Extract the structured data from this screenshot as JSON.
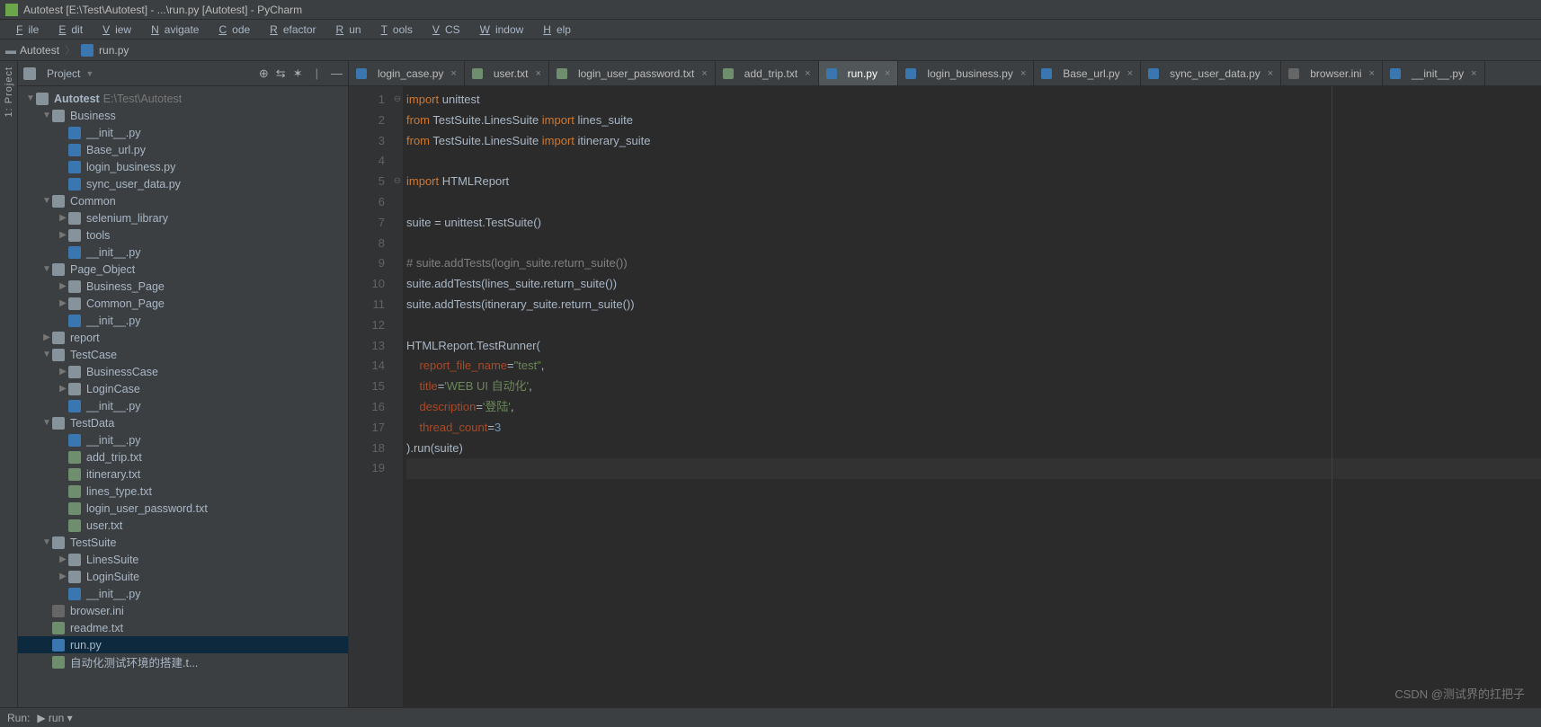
{
  "title": "Autotest [E:\\Test\\Autotest] - ...\\run.py [Autotest] - PyCharm",
  "menu": [
    "File",
    "Edit",
    "View",
    "Navigate",
    "Code",
    "Refactor",
    "Run",
    "Tools",
    "VCS",
    "Window",
    "Help"
  ],
  "crumbs": {
    "root": "Autotest",
    "file": "run.py"
  },
  "sidebar": {
    "title": "Project",
    "tree": [
      {
        "d": 0,
        "a": "d",
        "ic": "fold",
        "t": "Autotest",
        "p": "E:\\Test\\Autotest",
        "b": true
      },
      {
        "d": 1,
        "a": "d",
        "ic": "pkg",
        "t": "Business"
      },
      {
        "d": 2,
        "a": "n",
        "ic": "py",
        "t": "__init__.py"
      },
      {
        "d": 2,
        "a": "n",
        "ic": "py",
        "t": "Base_url.py"
      },
      {
        "d": 2,
        "a": "n",
        "ic": "py",
        "t": "login_business.py"
      },
      {
        "d": 2,
        "a": "n",
        "ic": "py",
        "t": "sync_user_data.py"
      },
      {
        "d": 1,
        "a": "d",
        "ic": "pkg",
        "t": "Common"
      },
      {
        "d": 2,
        "a": "r",
        "ic": "pkg",
        "t": "selenium_library"
      },
      {
        "d": 2,
        "a": "r",
        "ic": "pkg",
        "t": "tools"
      },
      {
        "d": 2,
        "a": "n",
        "ic": "py",
        "t": "__init__.py"
      },
      {
        "d": 1,
        "a": "d",
        "ic": "pkg",
        "t": "Page_Object"
      },
      {
        "d": 2,
        "a": "r",
        "ic": "pkg",
        "t": "Business_Page"
      },
      {
        "d": 2,
        "a": "r",
        "ic": "pkg",
        "t": "Common_Page"
      },
      {
        "d": 2,
        "a": "n",
        "ic": "py",
        "t": "__init__.py"
      },
      {
        "d": 1,
        "a": "r",
        "ic": "fold",
        "t": "report"
      },
      {
        "d": 1,
        "a": "d",
        "ic": "pkg",
        "t": "TestCase"
      },
      {
        "d": 2,
        "a": "r",
        "ic": "pkg",
        "t": "BusinessCase"
      },
      {
        "d": 2,
        "a": "r",
        "ic": "pkg",
        "t": "LoginCase"
      },
      {
        "d": 2,
        "a": "n",
        "ic": "py",
        "t": "__init__.py"
      },
      {
        "d": 1,
        "a": "d",
        "ic": "pkg",
        "t": "TestData"
      },
      {
        "d": 2,
        "a": "n",
        "ic": "py",
        "t": "__init__.py"
      },
      {
        "d": 2,
        "a": "n",
        "ic": "txt",
        "t": "add_trip.txt"
      },
      {
        "d": 2,
        "a": "n",
        "ic": "txt",
        "t": "itinerary.txt"
      },
      {
        "d": 2,
        "a": "n",
        "ic": "txt",
        "t": "lines_type.txt"
      },
      {
        "d": 2,
        "a": "n",
        "ic": "txt",
        "t": "login_user_password.txt"
      },
      {
        "d": 2,
        "a": "n",
        "ic": "txt",
        "t": "user.txt"
      },
      {
        "d": 1,
        "a": "d",
        "ic": "pkg",
        "t": "TestSuite"
      },
      {
        "d": 2,
        "a": "r",
        "ic": "pkg",
        "t": "LinesSuite"
      },
      {
        "d": 2,
        "a": "r",
        "ic": "pkg",
        "t": "LoginSuite"
      },
      {
        "d": 2,
        "a": "n",
        "ic": "py",
        "t": "__init__.py"
      },
      {
        "d": 1,
        "a": "n",
        "ic": "ini",
        "t": "browser.ini"
      },
      {
        "d": 1,
        "a": "n",
        "ic": "txt",
        "t": "readme.txt"
      },
      {
        "d": 1,
        "a": "n",
        "ic": "py",
        "t": "run.py",
        "sel": true
      },
      {
        "d": 1,
        "a": "n",
        "ic": "txt",
        "t": "自动化测试环境的搭建.t..."
      }
    ]
  },
  "tabs": [
    {
      "ic": "py",
      "t": "login_case.py"
    },
    {
      "ic": "txt",
      "t": "user.txt"
    },
    {
      "ic": "txt",
      "t": "login_user_password.txt"
    },
    {
      "ic": "txt",
      "t": "add_trip.txt"
    },
    {
      "ic": "py",
      "t": "run.py",
      "active": true
    },
    {
      "ic": "py",
      "t": "login_business.py"
    },
    {
      "ic": "py",
      "t": "Base_url.py"
    },
    {
      "ic": "py",
      "t": "sync_user_data.py"
    },
    {
      "ic": "ini",
      "t": "browser.ini"
    },
    {
      "ic": "py",
      "t": "__init__.py"
    }
  ],
  "code": {
    "lines": [
      [
        {
          "c": "kw",
          "t": "import"
        },
        {
          "t": " unittest"
        }
      ],
      [
        {
          "c": "kw",
          "t": "from"
        },
        {
          "t": " TestSuite.LinesSuite "
        },
        {
          "c": "kw",
          "t": "import"
        },
        {
          "t": " lines_suite"
        }
      ],
      [
        {
          "c": "kw",
          "t": "from"
        },
        {
          "t": " TestSuite.LinesSuite "
        },
        {
          "c": "kw",
          "t": "import"
        },
        {
          "t": " itinerary_suite"
        }
      ],
      [],
      [
        {
          "c": "kw",
          "t": "import"
        },
        {
          "t": " HTMLReport"
        }
      ],
      [],
      [
        {
          "t": "suite = unittest.TestSuite()"
        }
      ],
      [],
      [
        {
          "c": "cmt",
          "t": "# suite.addTests(login_suite.return_suite())"
        }
      ],
      [
        {
          "t": "suite.addTests(lines_suite.return_suite())"
        }
      ],
      [
        {
          "t": "suite.addTests(itinerary_suite.return_suite())"
        }
      ],
      [],
      [
        {
          "t": "HTMLReport.TestRunner("
        }
      ],
      [
        {
          "t": "    "
        },
        {
          "c": "kwarg",
          "t": "report_file_name"
        },
        {
          "t": "="
        },
        {
          "c": "str",
          "t": "\"test\""
        },
        {
          "t": ","
        }
      ],
      [
        {
          "t": "    "
        },
        {
          "c": "kwarg",
          "t": "title"
        },
        {
          "t": "="
        },
        {
          "c": "str",
          "t": "'WEB UI 自动化'"
        },
        {
          "t": ","
        }
      ],
      [
        {
          "t": "    "
        },
        {
          "c": "kwarg",
          "t": "description"
        },
        {
          "t": "="
        },
        {
          "c": "str",
          "t": "'登陆'"
        },
        {
          "t": ","
        }
      ],
      [
        {
          "t": "    "
        },
        {
          "c": "kwarg",
          "t": "thread_count"
        },
        {
          "t": "="
        },
        {
          "c": "num",
          "t": "3"
        }
      ],
      [
        {
          "t": ").run(suite)"
        }
      ],
      []
    ],
    "folds": {
      "1": "⊖",
      "5": "⊖"
    }
  },
  "status": {
    "run": "Run:",
    "cfg": "run"
  },
  "watermark": "CSDN @测试界的扛把子",
  "toolstrip": "1: Project"
}
